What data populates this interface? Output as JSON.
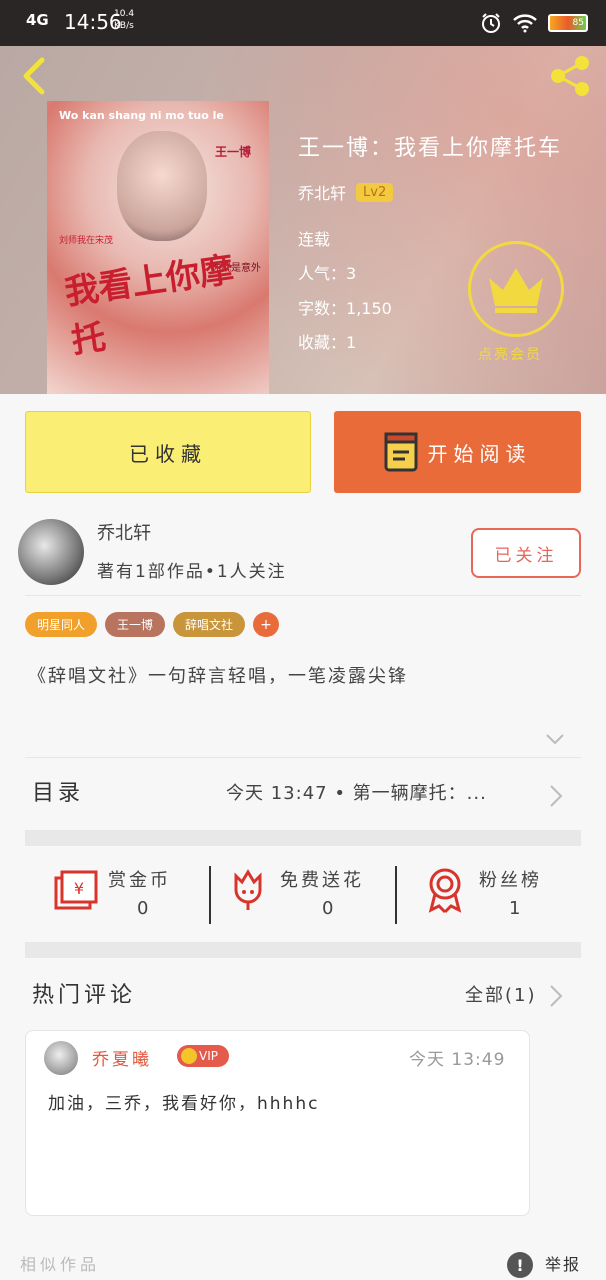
{
  "status_bar": {
    "network": "4G",
    "time": "14:56",
    "speed": "10.4 KB/s",
    "battery_icon": "battery-icon",
    "battery_level": "85"
  },
  "book": {
    "title": "王一博：我看上你摩托车",
    "cover_text": {
      "line1": "Wo kan shang ni mo tuo le",
      "author_mark": "王一博",
      "big": "我看上你摩托",
      "side": "你就是意外",
      "top_left": "刘师我在宋茂"
    },
    "author": "乔北轩",
    "level": "Lv2",
    "status": "连载",
    "popularity_label": "人气：",
    "popularity": "3",
    "words_label": "字数：",
    "words": "1,150",
    "collect_label": "收藏：",
    "collects": "1",
    "vip_label": "点亮会员"
  },
  "actions": {
    "favorite": "已收藏",
    "read": "开始阅读"
  },
  "author_card": {
    "name": "乔北轩",
    "subtitle": "著有1部作品•1人关注",
    "follow": "已关注"
  },
  "tags": [
    {
      "label": "明星同人",
      "color": "#f0a02b"
    },
    {
      "label": "王一博",
      "color": "#b8745e"
    },
    {
      "label": "辞唱文社",
      "color": "#c9953a"
    }
  ],
  "tag_add": "+",
  "description": "《辞唱文社》一句辞言轻唱，一笔凌露尖锋",
  "catalog": {
    "label": "目录",
    "latest": "今天 13:47 • 第一辆摩托：..."
  },
  "stats": [
    {
      "label": "赏金币",
      "value": "0",
      "icon": "red-envelope-icon"
    },
    {
      "label": "免费送花",
      "value": "0",
      "icon": "flower-icon"
    },
    {
      "label": "粉丝榜",
      "value": "1",
      "icon": "medal-icon"
    }
  ],
  "comments": {
    "header": "热门评论",
    "all": "全部(1)",
    "items": [
      {
        "name": "乔夏曦",
        "badge": "VIP",
        "time": "今天 13:49",
        "text": "加油，三乔，我看好你，hhhhc"
      }
    ]
  },
  "footer": {
    "similar": "相似作品",
    "report_icon": "!",
    "report": "举报"
  },
  "colors": {
    "accent_orange": "#ea6b3a",
    "favorite_yellow": "#fbee74",
    "follow_red": "#e8665a",
    "crown_gold": "#f3d940"
  }
}
